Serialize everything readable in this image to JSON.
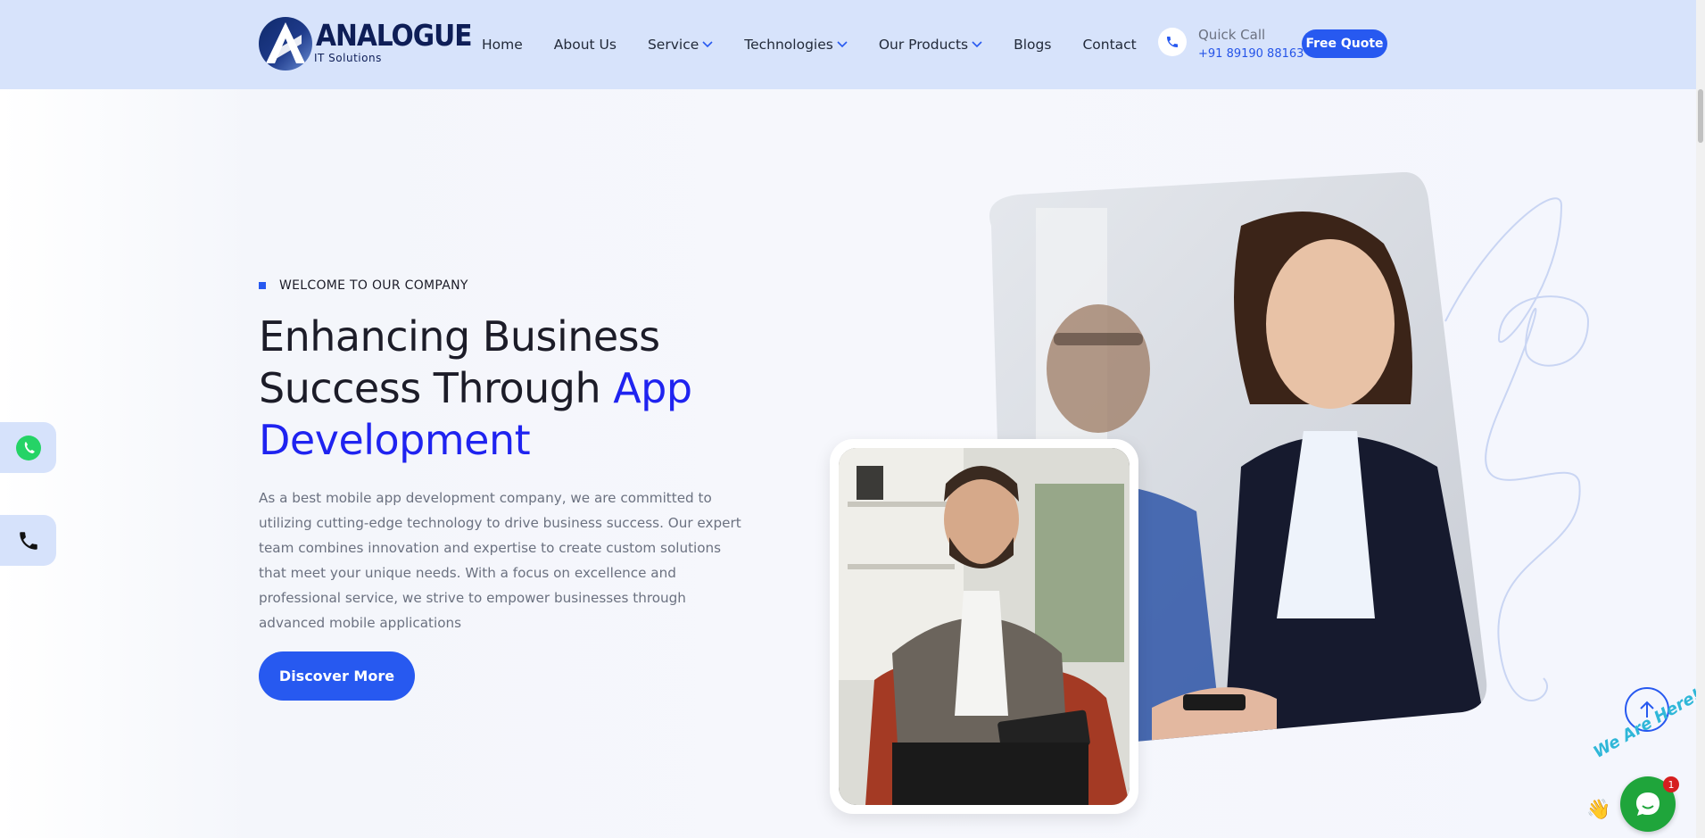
{
  "header": {
    "logo": {
      "name": "ANALOGUE",
      "subtitle": "IT Solutions"
    },
    "nav": [
      {
        "label": "Home",
        "has_dropdown": false
      },
      {
        "label": "About Us",
        "has_dropdown": false
      },
      {
        "label": "Service",
        "has_dropdown": true
      },
      {
        "label": "Technologies",
        "has_dropdown": true
      },
      {
        "label": "Our Products",
        "has_dropdown": true
      },
      {
        "label": "Blogs",
        "has_dropdown": false
      },
      {
        "label": "Contact",
        "has_dropdown": false
      }
    ],
    "quick_call": {
      "label": "Quick Call",
      "number": "+91 89190 88163",
      "icon": "phone-icon"
    },
    "quote_button": "Free Quote"
  },
  "hero": {
    "eyebrow": "WELCOME TO OUR COMPANY",
    "headline_main": "Enhancing Business Success Through ",
    "headline_accent": "App Development",
    "description": "As a best mobile app development company, we are committed to utilizing cutting-edge technology to drive business success. Our expert team combines innovation and expertise to create custom solutions that meet your unique needs. With a focus on excellence and professional service, we strive to empower businesses through advanced mobile applications",
    "cta": "Discover More"
  },
  "floating": {
    "whatsapp_icon": "whatsapp-icon",
    "phone_icon": "phone-icon",
    "scroll_top_icon": "arrow-up-icon",
    "chat": {
      "label": "We Are Here!",
      "badge": "1",
      "icon": "chat-bubble-icon"
    }
  },
  "colors": {
    "accent": "#2759f0",
    "headline_accent": "#1f23f0",
    "header_bg": "#d7e3fb",
    "chat_green": "#1fa53b"
  }
}
